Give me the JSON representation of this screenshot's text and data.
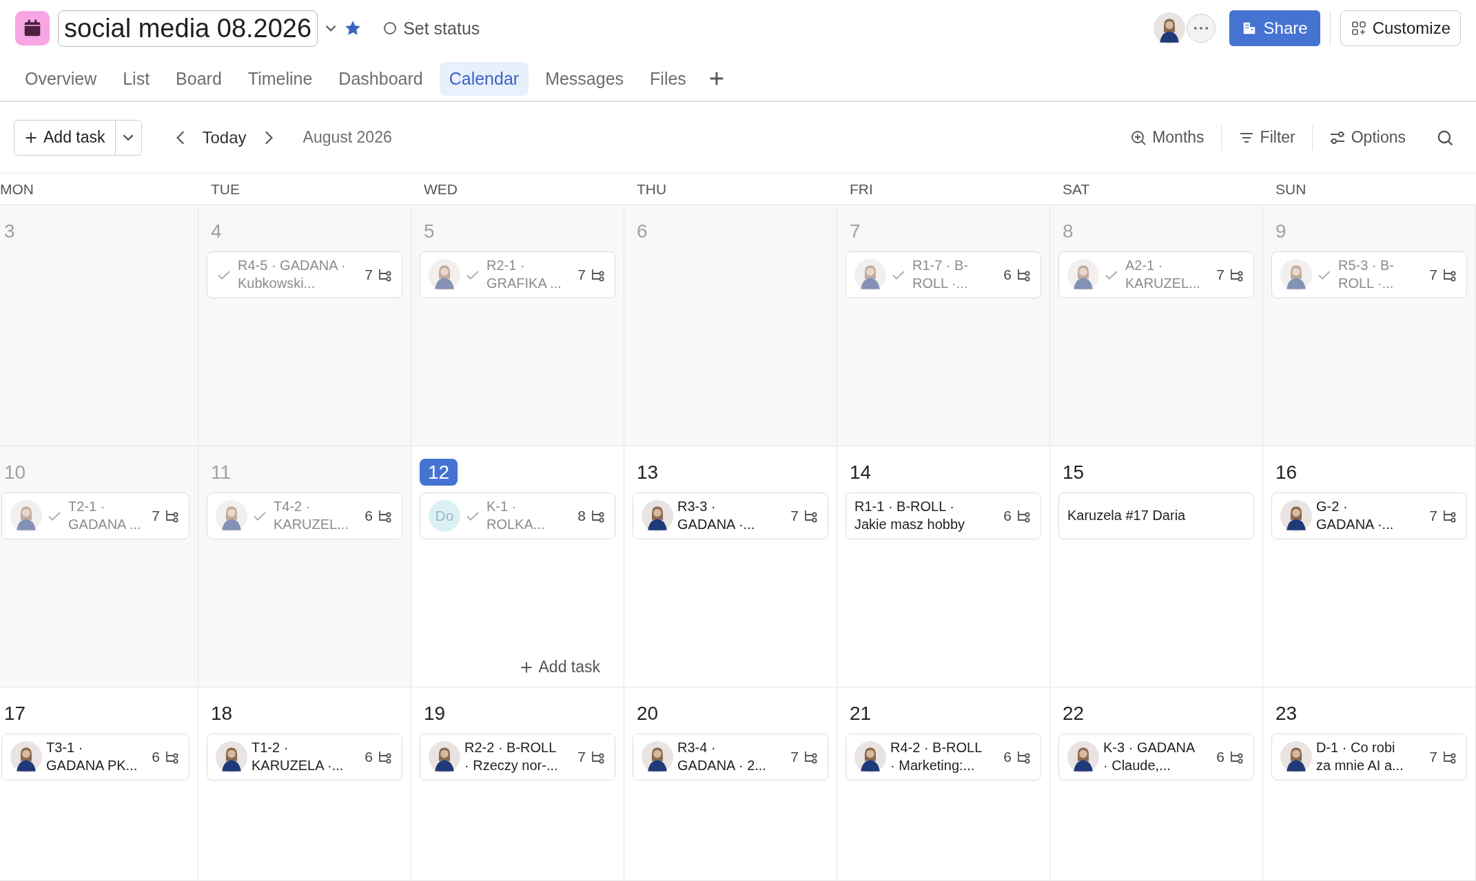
{
  "project": {
    "title": "social media 08.2026",
    "starred": true,
    "set_status": "Set status"
  },
  "share": "Share",
  "customize": "Customize",
  "tabs": [
    {
      "label": "Overview",
      "selected": false
    },
    {
      "label": "List",
      "selected": false
    },
    {
      "label": "Board",
      "selected": false
    },
    {
      "label": "Timeline",
      "selected": false
    },
    {
      "label": "Dashboard",
      "selected": false
    },
    {
      "label": "Calendar",
      "selected": true
    },
    {
      "label": "Messages",
      "selected": false
    },
    {
      "label": "Files",
      "selected": false
    }
  ],
  "toolbar": {
    "add_task": "Add task",
    "today": "Today",
    "month": "August 2026",
    "months": "Months",
    "filter": "Filter",
    "options": "Options"
  },
  "weekdays": [
    "MON",
    "TUE",
    "WED",
    "THU",
    "FRI",
    "SAT",
    "SUN"
  ],
  "weeks": [
    {
      "days": [
        {
          "number": "3",
          "past": true,
          "today": false
        },
        {
          "number": "4",
          "past": true,
          "today": false,
          "tasks": [
            {
              "kind": "plain",
              "title": "R4-5 · GADANA ·\nKubkowski...",
              "completed": true,
              "subtasks": "7"
            }
          ]
        },
        {
          "number": "5",
          "past": true,
          "today": false,
          "tasks": [
            {
              "kind": "avatar",
              "title": "R2-1 ·\nGRAFIKA ...",
              "completed": true,
              "subtasks": "7"
            }
          ]
        },
        {
          "number": "6",
          "past": true,
          "today": false
        },
        {
          "number": "7",
          "past": true,
          "today": false,
          "tasks": [
            {
              "kind": "avatar",
              "title": "R1-7 · B-\nROLL ·...",
              "completed": true,
              "subtasks": "6"
            }
          ]
        },
        {
          "number": "8",
          "past": true,
          "today": false,
          "tasks": [
            {
              "kind": "avatar",
              "title": "A2-1 ·\nKARUZEL...",
              "completed": true,
              "subtasks": "7"
            }
          ]
        },
        {
          "number": "9",
          "past": true,
          "today": false,
          "tasks": [
            {
              "kind": "avatar",
              "title": "R5-3 · B-\nROLL ·...",
              "completed": true,
              "subtasks": "7"
            }
          ]
        }
      ]
    },
    {
      "days": [
        {
          "number": "10",
          "past": true,
          "today": false,
          "tasks": [
            {
              "kind": "avatar",
              "title": "T2-1 ·\nGADANA ...",
              "completed": true,
              "subtasks": "7"
            }
          ]
        },
        {
          "number": "11",
          "past": true,
          "today": false,
          "tasks": [
            {
              "kind": "avatar",
              "title": "T4-2 ·\nKARUZEL...",
              "completed": true,
              "subtasks": "6"
            }
          ]
        },
        {
          "number": "12",
          "past": false,
          "today": true,
          "add_task": "Add task",
          "tasks": [
            {
              "kind": "initials",
              "initials": "Do",
              "title": "K-1 ·\nROLKA...",
              "completed": true,
              "subtasks": "8"
            }
          ]
        },
        {
          "number": "13",
          "past": false,
          "today": false,
          "tasks": [
            {
              "kind": "avatar",
              "title": "R3-3 ·\nGADANA ·...",
              "completed": false,
              "subtasks": "7"
            }
          ]
        },
        {
          "number": "14",
          "past": false,
          "today": false,
          "tasks": [
            {
              "kind": "plain",
              "title": "R1-1 · B-ROLL ·\nJakie masz hobby",
              "completed": false,
              "subtasks": "6"
            }
          ]
        },
        {
          "number": "15",
          "past": false,
          "today": false,
          "tasks": [
            {
              "kind": "plain",
              "title": "Karuzela #17 Daria",
              "completed": false
            }
          ]
        },
        {
          "number": "16",
          "past": false,
          "today": false,
          "tasks": [
            {
              "kind": "avatar",
              "title": "G-2 ·\nGADANA ·...",
              "completed": false,
              "subtasks": "7"
            }
          ]
        }
      ]
    },
    {
      "days": [
        {
          "number": "17",
          "past": false,
          "today": false,
          "tasks": [
            {
              "kind": "avatar",
              "title": "T3-1 ·\nGADANA PK...",
              "completed": false,
              "subtasks": "6"
            }
          ]
        },
        {
          "number": "18",
          "past": false,
          "today": false,
          "tasks": [
            {
              "kind": "avatar",
              "title": "T1-2 ·\nKARUZELA ·...",
              "completed": false,
              "subtasks": "6"
            }
          ]
        },
        {
          "number": "19",
          "past": false,
          "today": false,
          "tasks": [
            {
              "kind": "avatar",
              "title": "R2-2 · B-ROLL\n· Rzeczy nor-...",
              "completed": false,
              "subtasks": "7"
            }
          ]
        },
        {
          "number": "20",
          "past": false,
          "today": false,
          "tasks": [
            {
              "kind": "avatar",
              "title": "R3-4 ·\nGADANA · 2...",
              "completed": false,
              "subtasks": "7"
            }
          ]
        },
        {
          "number": "21",
          "past": false,
          "today": false,
          "tasks": [
            {
              "kind": "avatar",
              "title": "R4-2 · B-ROLL\n· Marketing:...",
              "completed": false,
              "subtasks": "6"
            }
          ]
        },
        {
          "number": "22",
          "past": false,
          "today": false,
          "tasks": [
            {
              "kind": "avatar",
              "title": "K-3 · GADANA\n· Claude,...",
              "completed": false,
              "subtasks": "6"
            }
          ]
        },
        {
          "number": "23",
          "past": false,
          "today": false,
          "tasks": [
            {
              "kind": "avatar",
              "title": "D-1 · Co robi\nza mnie AI a...",
              "completed": false,
              "subtasks": "7"
            }
          ]
        }
      ]
    }
  ]
}
